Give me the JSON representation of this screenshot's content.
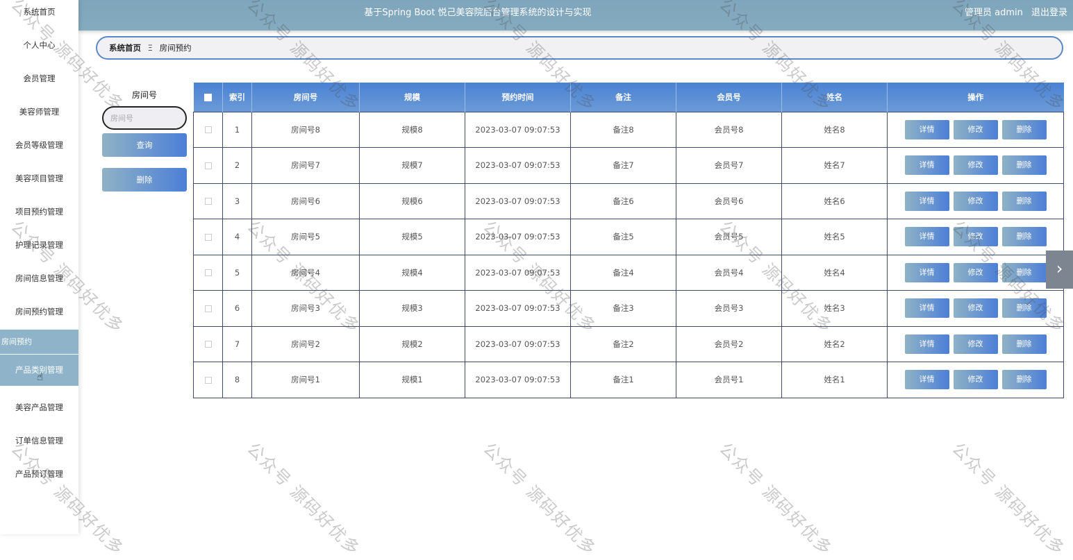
{
  "header": {
    "title": "基于Spring Boot 悦己美容院后台管理系统的设计与实现",
    "user_label": "管理员 admin",
    "logout": "退出登录"
  },
  "sidebar": {
    "items": [
      "系统首页",
      "个人中心",
      "会员管理",
      "美容师管理",
      "会员等级管理",
      "美容项目管理",
      "项目预约管理",
      "护理记录管理",
      "房间信息管理",
      "房间预约管理"
    ],
    "sub_header": "房间预约",
    "sub_item": "产品类别管理",
    "items_after": [
      "美容产品管理",
      "订单信息管理",
      "产品预订管理"
    ]
  },
  "breadcrumb": {
    "home": "系统首页",
    "separator": "Ξ",
    "current": "房间预约"
  },
  "search": {
    "label": "房间号",
    "placeholder": "房间号",
    "query_button": "查询",
    "delete_button": "删除"
  },
  "table": {
    "headers": [
      "索引",
      "房间号",
      "规模",
      "预约时间",
      "备注",
      "会员号",
      "姓名",
      "操作"
    ],
    "rows": [
      {
        "index": "1",
        "room": "房间号8",
        "scale": "规模8",
        "time": "2023-03-07 09:07:53",
        "note": "备注8",
        "member": "会员号8",
        "name": "姓名8"
      },
      {
        "index": "2",
        "room": "房间号7",
        "scale": "规模7",
        "time": "2023-03-07 09:07:53",
        "note": "备注7",
        "member": "会员号7",
        "name": "姓名7"
      },
      {
        "index": "3",
        "room": "房间号6",
        "scale": "规模6",
        "time": "2023-03-07 09:07:53",
        "note": "备注6",
        "member": "会员号6",
        "name": "姓名6"
      },
      {
        "index": "4",
        "room": "房间号5",
        "scale": "规模5",
        "time": "2023-03-07 09:07:53",
        "note": "备注5",
        "member": "会员号5",
        "name": "姓名5"
      },
      {
        "index": "5",
        "room": "房间号4",
        "scale": "规模4",
        "time": "2023-03-07 09:07:53",
        "note": "备注4",
        "member": "会员号4",
        "name": "姓名4"
      },
      {
        "index": "6",
        "room": "房间号3",
        "scale": "规模3",
        "time": "2023-03-07 09:07:53",
        "note": "备注3",
        "member": "会员号3",
        "name": "姓名3"
      },
      {
        "index": "7",
        "room": "房间号2",
        "scale": "规模2",
        "time": "2023-03-07 09:07:53",
        "note": "备注2",
        "member": "会员号2",
        "name": "姓名2"
      },
      {
        "index": "8",
        "room": "房间号1",
        "scale": "规模1",
        "time": "2023-03-07 09:07:53",
        "note": "备注1",
        "member": "会员号1",
        "name": "姓名1"
      }
    ],
    "actions": {
      "detail": "详情",
      "edit": "修改",
      "delete": "删除"
    }
  },
  "watermark": "公众号 源码好优多",
  "icons": {
    "next": "chevron-right-icon",
    "cursor": "hand-pointer-icon"
  },
  "colors": {
    "header": "#80a7bd",
    "accent": "#4c7fd8",
    "sidebar_active": "#8fb4c9"
  }
}
